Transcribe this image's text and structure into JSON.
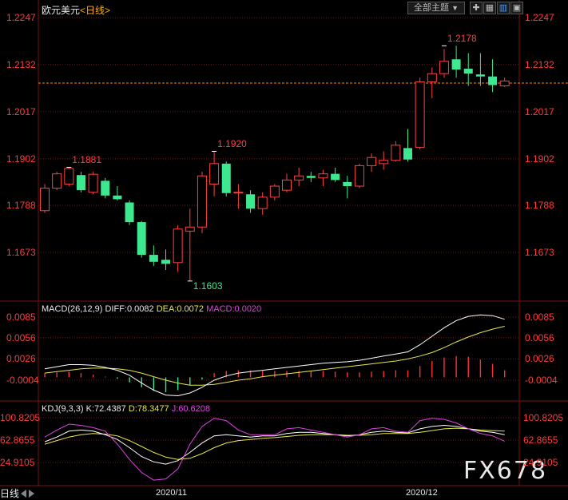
{
  "header": {
    "symbol": "欧元美元",
    "period": "<日线>",
    "theme_button": "全部主题",
    "theme_arrow": "▼"
  },
  "colors": {
    "up": "#ff4040",
    "down": "#3ee890",
    "grid": "#7a1010",
    "axis_label": "#ff3b3b",
    "current_price_line": "#ff8800",
    "macd_diff": "#ffffff",
    "macd_dea": "#e8e84a",
    "macd_bar": "#ff3030",
    "kdj_k": "#ffffff",
    "kdj_d": "#e8e84a",
    "kdj_j": "#e040e0"
  },
  "price_axis": {
    "ticks": [
      "1.2247",
      "1.2132",
      "1.2017",
      "1.1902",
      "1.1788",
      "1.1673"
    ],
    "current_price": 1.2087
  },
  "annotations": [
    {
      "label": "1.1881",
      "price": 1.1881,
      "bar": 2
    },
    {
      "label": "1.1920",
      "price": 1.192,
      "bar": 14
    },
    {
      "label": "1.1603",
      "price": 1.1603,
      "bar": 12
    },
    {
      "label": "1.2178",
      "price": 1.2178,
      "bar": 33
    }
  ],
  "macd": {
    "title": "MACD(26,12,9)",
    "diff_label": "DIFF:0.0082",
    "dea_label": "DEA:0.0072",
    "macd_label": "MACD:0.0020",
    "ticks": [
      "0.0085",
      "0.0056",
      "0.0026",
      "-0.0004"
    ]
  },
  "kdj": {
    "title": "KDJ(9,3,3)",
    "k_label": "K:72.4387",
    "d_label": "D:78.3477",
    "j_label": "J:60.6208",
    "ticks": [
      "100.8205",
      "62.8655",
      "24.9105"
    ]
  },
  "time_axis": {
    "labels": [
      "2020/11",
      "2020/12"
    ],
    "corner_label": "日线"
  },
  "watermark": "FX678",
  "chart_data": {
    "type": "candlestick",
    "title": "欧元美元<日线>",
    "ylim": [
      1.1603,
      1.2247
    ],
    "candles": [
      {
        "o": 1.1775,
        "h": 1.184,
        "l": 1.177,
        "c": 1.183
      },
      {
        "o": 1.183,
        "h": 1.187,
        "l": 1.1825,
        "c": 1.1865
      },
      {
        "o": 1.184,
        "h": 1.1881,
        "l": 1.1835,
        "c": 1.1878
      },
      {
        "o": 1.1862,
        "h": 1.187,
        "l": 1.182,
        "c": 1.1825
      },
      {
        "o": 1.182,
        "h": 1.187,
        "l": 1.1815,
        "c": 1.1864
      },
      {
        "o": 1.1848,
        "h": 1.1855,
        "l": 1.1805,
        "c": 1.1812
      },
      {
        "o": 1.1812,
        "h": 1.1835,
        "l": 1.18,
        "c": 1.1803
      },
      {
        "o": 1.1795,
        "h": 1.18,
        "l": 1.174,
        "c": 1.1747
      },
      {
        "o": 1.1747,
        "h": 1.175,
        "l": 1.166,
        "c": 1.1667
      },
      {
        "o": 1.1667,
        "h": 1.169,
        "l": 1.164,
        "c": 1.165
      },
      {
        "o": 1.1655,
        "h": 1.168,
        "l": 1.163,
        "c": 1.1645
      },
      {
        "o": 1.1648,
        "h": 1.174,
        "l": 1.1625,
        "c": 1.173
      },
      {
        "o": 1.1725,
        "h": 1.178,
        "l": 1.1603,
        "c": 1.1735
      },
      {
        "o": 1.1735,
        "h": 1.187,
        "l": 1.172,
        "c": 1.186
      },
      {
        "o": 1.184,
        "h": 1.192,
        "l": 1.181,
        "c": 1.189
      },
      {
        "o": 1.189,
        "h": 1.1895,
        "l": 1.181,
        "c": 1.1818
      },
      {
        "o": 1.1818,
        "h": 1.184,
        "l": 1.178,
        "c": 1.182
      },
      {
        "o": 1.1815,
        "h": 1.1825,
        "l": 1.177,
        "c": 1.178
      },
      {
        "o": 1.178,
        "h": 1.182,
        "l": 1.1765,
        "c": 1.1808
      },
      {
        "o": 1.1808,
        "h": 1.184,
        "l": 1.18,
        "c": 1.1835
      },
      {
        "o": 1.1825,
        "h": 1.1865,
        "l": 1.182,
        "c": 1.185
      },
      {
        "o": 1.185,
        "h": 1.188,
        "l": 1.1835,
        "c": 1.186
      },
      {
        "o": 1.186,
        "h": 1.187,
        "l": 1.1845,
        "c": 1.1855
      },
      {
        "o": 1.1855,
        "h": 1.1875,
        "l": 1.1835,
        "c": 1.1865
      },
      {
        "o": 1.1865,
        "h": 1.188,
        "l": 1.1845,
        "c": 1.185
      },
      {
        "o": 1.1845,
        "h": 1.186,
        "l": 1.1805,
        "c": 1.1835
      },
      {
        "o": 1.1835,
        "h": 1.189,
        "l": 1.183,
        "c": 1.1885
      },
      {
        "o": 1.1885,
        "h": 1.1915,
        "l": 1.187,
        "c": 1.1905
      },
      {
        "o": 1.189,
        "h": 1.192,
        "l": 1.1875,
        "c": 1.1898
      },
      {
        "o": 1.1898,
        "h": 1.1945,
        "l": 1.1895,
        "c": 1.1935
      },
      {
        "o": 1.1928,
        "h": 1.1975,
        "l": 1.1895,
        "c": 1.19
      },
      {
        "o": 1.193,
        "h": 1.21,
        "l": 1.1925,
        "c": 1.209
      },
      {
        "o": 1.209,
        "h": 1.2125,
        "l": 1.205,
        "c": 1.211
      },
      {
        "o": 1.211,
        "h": 1.217,
        "l": 1.21,
        "c": 1.214
      },
      {
        "o": 1.2145,
        "h": 1.2178,
        "l": 1.21,
        "c": 1.212
      },
      {
        "o": 1.2122,
        "h": 1.216,
        "l": 1.208,
        "c": 1.211
      },
      {
        "o": 1.2108,
        "h": 1.216,
        "l": 1.208,
        "c": 1.2103
      },
      {
        "o": 1.2103,
        "h": 1.2145,
        "l": 1.2065,
        "c": 1.2082
      },
      {
        "o": 1.208,
        "h": 1.21,
        "l": 1.2077,
        "c": 1.2092
      }
    ],
    "macd_diff": [
      0.0012,
      0.0015,
      0.0018,
      0.0018,
      0.0017,
      0.0014,
      0.001,
      0.0003,
      -0.0008,
      -0.0018,
      -0.0025,
      -0.0026,
      -0.0022,
      -0.0014,
      -0.0004,
      0.0002,
      0.0006,
      0.0008,
      0.001,
      0.0012,
      0.0014,
      0.0016,
      0.0018,
      0.002,
      0.0021,
      0.0022,
      0.0024,
      0.0027,
      0.003,
      0.0033,
      0.0036,
      0.0046,
      0.0058,
      0.007,
      0.008,
      0.0086,
      0.0088,
      0.0087,
      0.0082
    ],
    "macd_dea": [
      0.0006,
      0.0008,
      0.001,
      0.0012,
      0.0013,
      0.0013,
      0.0012,
      0.001,
      0.0006,
      0.0001,
      -0.0004,
      -0.0008,
      -0.0011,
      -0.0011,
      -0.001,
      -0.0007,
      -0.0004,
      -0.0002,
      0.0001,
      0.0003,
      0.0005,
      0.0007,
      0.0009,
      0.0011,
      0.0013,
      0.0015,
      0.0017,
      0.0019,
      0.0021,
      0.0023,
      0.0026,
      0.003,
      0.0035,
      0.0042,
      0.005,
      0.0057,
      0.0063,
      0.0068,
      0.0072
    ],
    "macd_hist": [
      0.0006,
      0.0007,
      0.0008,
      0.0006,
      0.0004,
      0.0001,
      -0.0002,
      -0.0007,
      -0.0014,
      -0.0019,
      -0.0021,
      -0.0018,
      -0.0011,
      -0.0003,
      0.0006,
      0.0009,
      0.001,
      0.001,
      0.0009,
      0.0009,
      0.0009,
      0.0009,
      0.0009,
      0.0009,
      0.0008,
      0.0007,
      0.0007,
      0.0008,
      0.0009,
      0.001,
      0.001,
      0.0016,
      0.0023,
      0.0028,
      0.003,
      0.0029,
      0.0025,
      0.0019,
      0.001
    ],
    "kdj_k": [
      60,
      68,
      78,
      80,
      78,
      72,
      64,
      50,
      35,
      26,
      22,
      28,
      42,
      58,
      70,
      72,
      70,
      68,
      70,
      70,
      74,
      76,
      76,
      74,
      72,
      70,
      72,
      76,
      78,
      76,
      75,
      82,
      86,
      88,
      86,
      82,
      78,
      76,
      72
    ],
    "kdj_d": [
      56,
      62,
      68,
      72,
      74,
      73,
      70,
      62,
      52,
      42,
      34,
      30,
      32,
      40,
      50,
      58,
      62,
      64,
      66,
      67,
      69,
      71,
      72,
      72,
      72,
      71,
      71,
      72,
      74,
      74,
      74,
      76,
      79,
      82,
      83,
      82,
      80,
      79,
      78
    ],
    "kdj_j": [
      68,
      80,
      90,
      88,
      84,
      78,
      56,
      30,
      8,
      -5,
      -3,
      14,
      56,
      86,
      100,
      96,
      80,
      72,
      72,
      72,
      82,
      84,
      80,
      76,
      72,
      68,
      72,
      82,
      84,
      78,
      76,
      96,
      100,
      98,
      92,
      82,
      74,
      70,
      61
    ]
  }
}
